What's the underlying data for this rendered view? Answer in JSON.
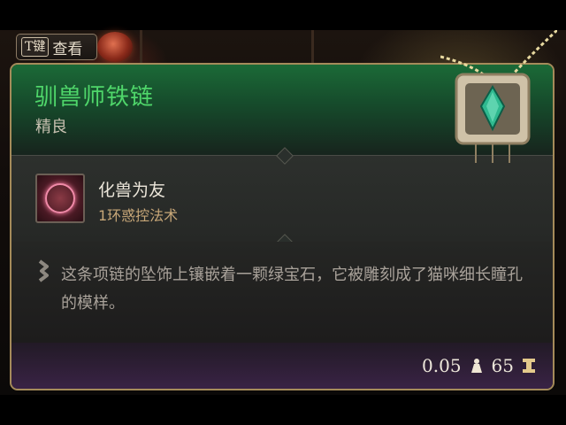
{
  "hint": {
    "key": "T键",
    "label": "查看"
  },
  "tooltip": {
    "title": "驯兽师铁链",
    "rarity": "精良",
    "spell": {
      "name": "化兽为友",
      "level": "1环惑控法术",
      "icon": "charm-beast-icon"
    },
    "description": "这条项链的坠饰上镶嵌着一颗绿宝石，它被雕刻成了猫咪细长瞳孔的模样。",
    "weight": "0.05",
    "price": "65",
    "colors": {
      "title": "#4fd66a",
      "rarity_green": "#1b6a37",
      "border": "#a58b5a"
    }
  }
}
